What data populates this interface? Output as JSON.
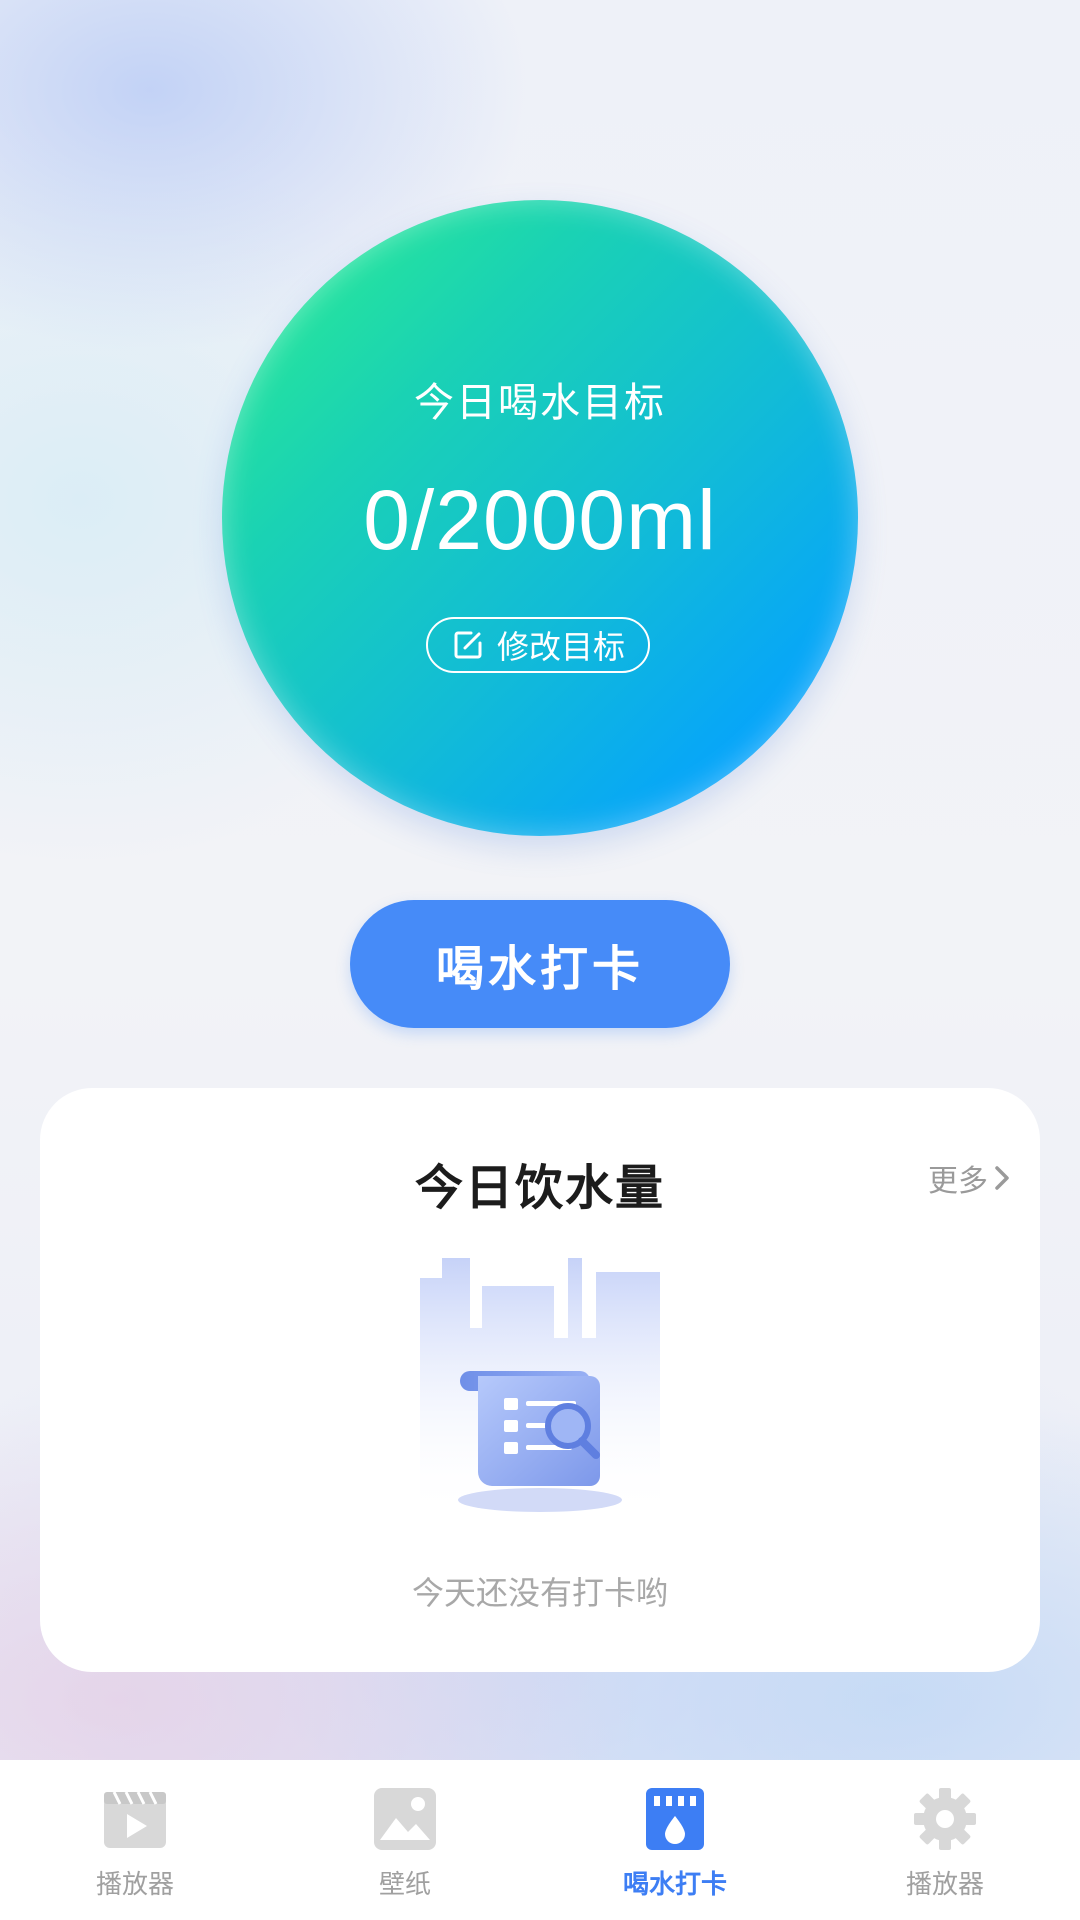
{
  "goal": {
    "title": "今日喝水目标",
    "value": "0/2000ml",
    "edit_label": "修改目标"
  },
  "checkin": {
    "label": "喝水打卡"
  },
  "today_card": {
    "title": "今日饮水量",
    "more_label": "更多",
    "empty_text": "今天还没有打卡哟"
  },
  "nav": {
    "items": [
      {
        "label": "播放器",
        "icon": "film-play-icon",
        "active": false
      },
      {
        "label": "壁纸",
        "icon": "image-icon",
        "active": false
      },
      {
        "label": "喝水打卡",
        "icon": "water-checkin-icon",
        "active": true
      },
      {
        "label": "播放器",
        "icon": "gear-icon",
        "active": false
      }
    ]
  },
  "colors": {
    "accent": "#468bf8",
    "nav_active": "#3d7ef4",
    "nav_inactive": "#a0a0a0",
    "circle_start": "#2ef08e",
    "circle_end": "#0aa0ff"
  }
}
